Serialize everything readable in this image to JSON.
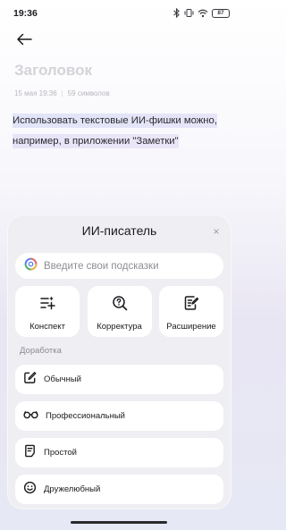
{
  "status_bar": {
    "time": "19:36",
    "battery": "87",
    "icons": [
      "bluetooth-icon",
      "vibrate-icon",
      "wifi-icon",
      "battery-icon"
    ]
  },
  "note": {
    "title": "Заголовок",
    "date": "15 мая 19:36",
    "separator": "|",
    "char_count": "59 символов",
    "body": "Использовать текстовые ИИ-фишки можно, например, в приложении \"Заметки\""
  },
  "ai_writer": {
    "title": "ИИ-писатель",
    "close_icon": "×",
    "prompt_placeholder": "Введите свои подсказки",
    "actions": [
      {
        "label": "Конспект",
        "icon": "summary-icon"
      },
      {
        "label": "Корректура",
        "icon": "proofread-icon"
      },
      {
        "label": "Расширение",
        "icon": "expand-icon"
      }
    ],
    "section_label": "Доработка",
    "tones": [
      {
        "label": "Обычный",
        "icon": "edit-icon"
      },
      {
        "label": "Профессиональный",
        "icon": "glasses-icon"
      },
      {
        "label": "Простой",
        "icon": "document-icon"
      },
      {
        "label": "Дружелюбный",
        "icon": "smile-icon"
      }
    ]
  },
  "colors": {
    "text_primary": "#1b1b1f",
    "title_placeholder": "#d3d3d8",
    "panel_bg": "#efeef3",
    "highlight": "#d6d2f3"
  }
}
